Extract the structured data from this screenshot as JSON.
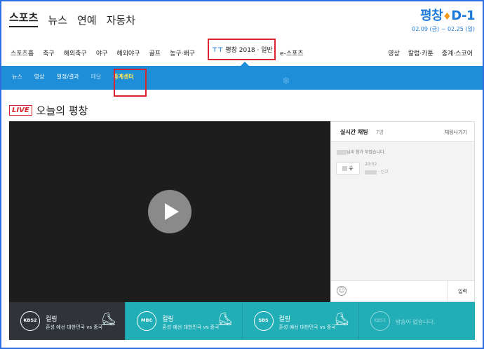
{
  "top_nav": {
    "items": [
      "스포츠",
      "뉴스",
      "연예",
      "자동차"
    ]
  },
  "brand": {
    "logo_text": "평창",
    "logo_suffix": "D-1",
    "dates": "02.09 (금) ~ 02.25 (일)"
  },
  "sub_nav": {
    "left": [
      "스포츠홈",
      "축구",
      "해외축구",
      "야구",
      "해외야구",
      "골프",
      "농구·배구"
    ],
    "pyeongchang_tab": {
      "label": "평창 2018 · 일반"
    },
    "esports": "e-스포츠",
    "right": [
      "영상",
      "칼럼·카툰",
      "중계·스코어"
    ]
  },
  "blue_bar": {
    "items": [
      {
        "label": "뉴스"
      },
      {
        "label": "영상"
      },
      {
        "label": "일정/결과"
      },
      {
        "label": "메달"
      },
      {
        "label": "중계센터"
      }
    ]
  },
  "section": {
    "live_badge": "LIVE",
    "title": "오늘의 평창"
  },
  "chat": {
    "title": "실시간 채팅",
    "count": "7명",
    "exit_label": "채팅나가기",
    "join_message": "님이 참가 하였습니다.",
    "user_label": "슈",
    "msg_time": "20:02",
    "msg_action": "· 신고",
    "send_label": "입력"
  },
  "channels": [
    {
      "logo": "KBS2",
      "sport": "컬링",
      "desc": "혼성 예선 대한민국 vs 중국"
    },
    {
      "logo": "MBC",
      "sport": "컬링",
      "desc": "혼성 예선 대한민국 vs 중국"
    },
    {
      "logo": "SBS",
      "sport": "컬링",
      "desc": "혼성 예선 대한민국 vs 중국"
    },
    {
      "logo": "KBS1",
      "none": "방송이 없습니다."
    }
  ],
  "colors": {
    "accent_blue": "#1e8ed8",
    "highlight_red": "#d9262e",
    "channel_teal": "#21aeb6",
    "channel_dark": "#30333a"
  }
}
